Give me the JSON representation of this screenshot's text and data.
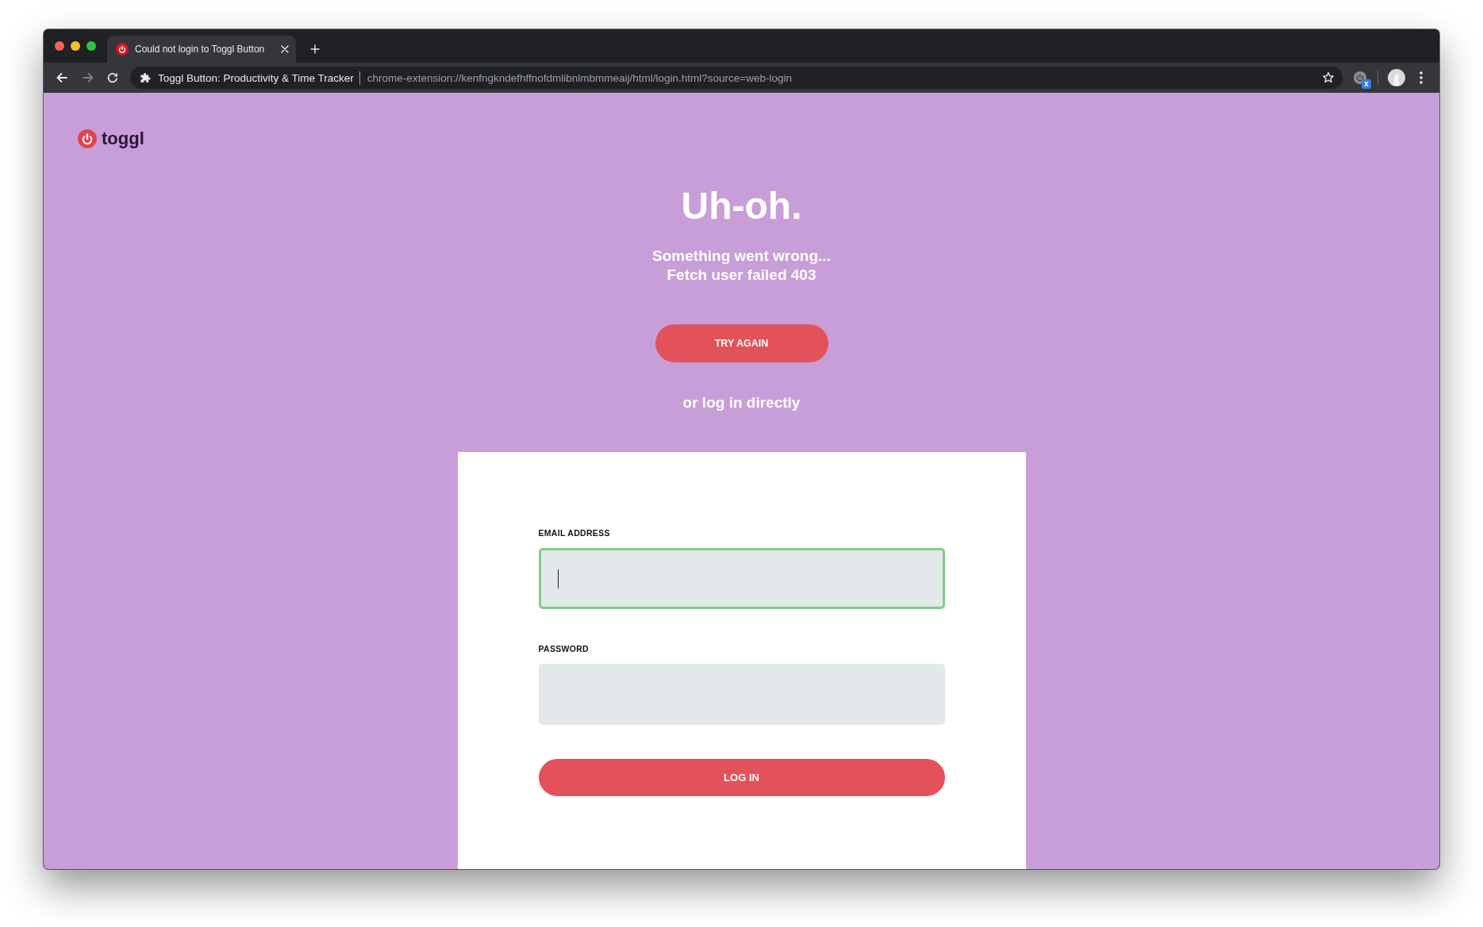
{
  "window": {
    "traffic_lights": [
      {
        "color": "#ff5f57"
      },
      {
        "color": "#febc2e"
      },
      {
        "color": "#28c840"
      }
    ]
  },
  "tabs": [
    {
      "title": "Could not login to Toggl Button",
      "selected": true
    }
  ],
  "toolbar": {
    "forward_disabled": true,
    "address_bar": {
      "site_name": "Toggl Button: Productivity & Time Tracker",
      "url": "chrome-extension://kenfngkndefhffnofdmlibnlmbmmeaij/html/login.html?source=web-login"
    },
    "extension_badge": "x"
  },
  "page": {
    "logo": "toggl",
    "heading": "Uh-oh.",
    "message": [
      "Something went wrong...",
      "Fetch user failed 403"
    ],
    "retry_button": "TRY AGAIN",
    "alternative_text": "or log in directly",
    "login_form": {
      "fields": [
        {
          "label": "EMAIL ADDRESS",
          "focused": true
        },
        {
          "label": "PASSWORD",
          "focused": false
        }
      ],
      "submit_button": "LOG IN"
    }
  }
}
